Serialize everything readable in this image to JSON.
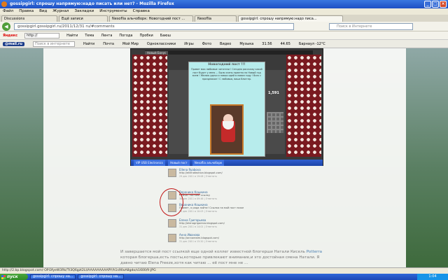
{
  "window": {
    "title": "gossipgirl: спрошу напрямую:надо писать или нет? - Mozilla Firefox"
  },
  "menu": [
    "Файл",
    "Правка",
    "Вид",
    "Журнал",
    "Закладки",
    "Инструменты",
    "Справка"
  ],
  "browser_tabs": [
    {
      "label": "Discussions"
    },
    {
      "label": "Ещё записи"
    },
    {
      "label": "Nesoflia альчоборк: Новогодний пост ..."
    },
    {
      "label": "Nesoflia"
    },
    {
      "label": "gossipgirl: спрошу напрямую:надо писа..."
    }
  ],
  "nav": {
    "url": "gossipgirl.gossipgirl.ru/2011/12/31 ru/#comments",
    "search_placeholder": "Поиск в Интернете"
  },
  "yandex_bar": {
    "logo": "Яндекс",
    "input": "http://",
    "find": "Найти",
    "tvm": "Тема",
    "items": [
      "Лента",
      "Погода",
      "Пробки",
      "Баюш"
    ]
  },
  "mail_bar": {
    "logo": "@mail.ru",
    "search_placeholder": "Поиск в интернете",
    "items": [
      "Найти",
      "Почта",
      "Мой Мир",
      "Одноклассники",
      "Игры",
      "Фото",
      "Видео",
      "Музыка",
      "31.56",
      "44.65",
      "Барнаул -12°C"
    ]
  },
  "screenshot": {
    "tab_label": "Новый Бонус",
    "post_title": "Новогодний пост !!!",
    "post_text": "Привет мои любимые читатели ! Сегодня расскажу какой пост будет у меня ... Было очень приятно на Новый год всем ! Желаю удачи и новых идей в новом году ! Всех с праздником ! С любовью, ваша блоггер.",
    "stat": "1,591",
    "taskbar_items": [
      "VIP USB Electronics",
      "Новый пост",
      "Nesoflia альчоборк"
    ]
  },
  "comments": [
    {
      "name": "Ellena Ryabova",
      "text": "http://ellenafashion.blogspot.com/",
      "date": "29 дек 2011 в 19:08 | Ответить"
    },
    {
      "name": "Вероника Кошкина",
      "text": "Сейчас поставь ссылку ",
      "date": "30 дек 2011 в 09:46 | Ответить"
    },
    {
      "name": "Вероника Кошкина",
      "text": "Привет, я рада зайти! Ссылка на мой пост ниже",
      "date": "30 дек 2011 в 10:03 | Ответить"
    },
    {
      "name": "Елена Григорьева",
      "text": "http://elenagrigoreva.blogspot.com/",
      "date": "31 дек 2011 в 14:01 | Ответить"
    },
    {
      "name": "Анна Иванова",
      "text": "http://annarealm.blogspot.com/",
      "date": "31 дек 2011 в 15:20 | Ответить"
    }
  ],
  "article": {
    "text": "И завершается мой пост ссылкой еще одной коллег известной блогерши Натали Кисель",
    "link": "Potterra",
    "text2": "которая блогерша,есть посты,которые привлекают внимание,и это достойная смена Натали. Я давно читаю Elena Freeze,хотя как читаю ... её пост мне не ..."
  },
  "status": {
    "text": "http://2.bp.blogspot.com/-OPl3fyeW3Rk/Tt3Q6gzt2LI/AAAAAAAAAPY/h1s90oA8gdo/s1600/fr.JPG"
  },
  "taskbar": {
    "start": "пуск",
    "items": [
      "gossipgirl: спрошу на...",
      "gossipgirl: спрошу на..."
    ],
    "clock": "1:04"
  }
}
